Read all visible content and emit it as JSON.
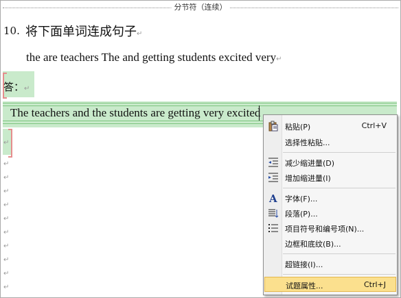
{
  "document": {
    "section_break_label": "分节符（连续）",
    "paragraph_mark": "↵",
    "question_number": "10.",
    "question_text": "将下面单词连成句子",
    "scrambled_words": "the are teachers The and getting students excited very",
    "answer_label": "答：",
    "answer_text": "The teachers and the students are getting very excited"
  },
  "context_menu": {
    "items": [
      {
        "label": "粘贴(P)",
        "shortcut": "Ctrl+V",
        "icon": "paste-icon"
      },
      {
        "label": "选择性粘贴...",
        "shortcut": "",
        "icon": ""
      },
      {
        "label": "减少缩进量(D)",
        "shortcut": "",
        "icon": "decrease-indent-icon"
      },
      {
        "label": "增加缩进量(I)",
        "shortcut": "",
        "icon": "increase-indent-icon"
      },
      {
        "label": "字体(F)...",
        "shortcut": "",
        "icon": "font-icon"
      },
      {
        "label": "段落(P)...",
        "shortcut": "",
        "icon": "paragraph-icon"
      },
      {
        "label": "项目符号和编号项(N)...",
        "shortcut": "",
        "icon": "bullets-icon"
      },
      {
        "label": "边框和底纹(B)...",
        "shortcut": "",
        "icon": ""
      },
      {
        "label": "超链接(I)...",
        "shortcut": "",
        "icon": ""
      },
      {
        "label": "试题属性...",
        "shortcut": "Ctrl+J",
        "icon": ""
      }
    ],
    "highlighted_index": 9,
    "highlight_color": "#fbe08e"
  },
  "colors": {
    "answer_fill": "#c9eacb",
    "bracket": "#e58d8d",
    "band_line": "#7dc57f"
  }
}
